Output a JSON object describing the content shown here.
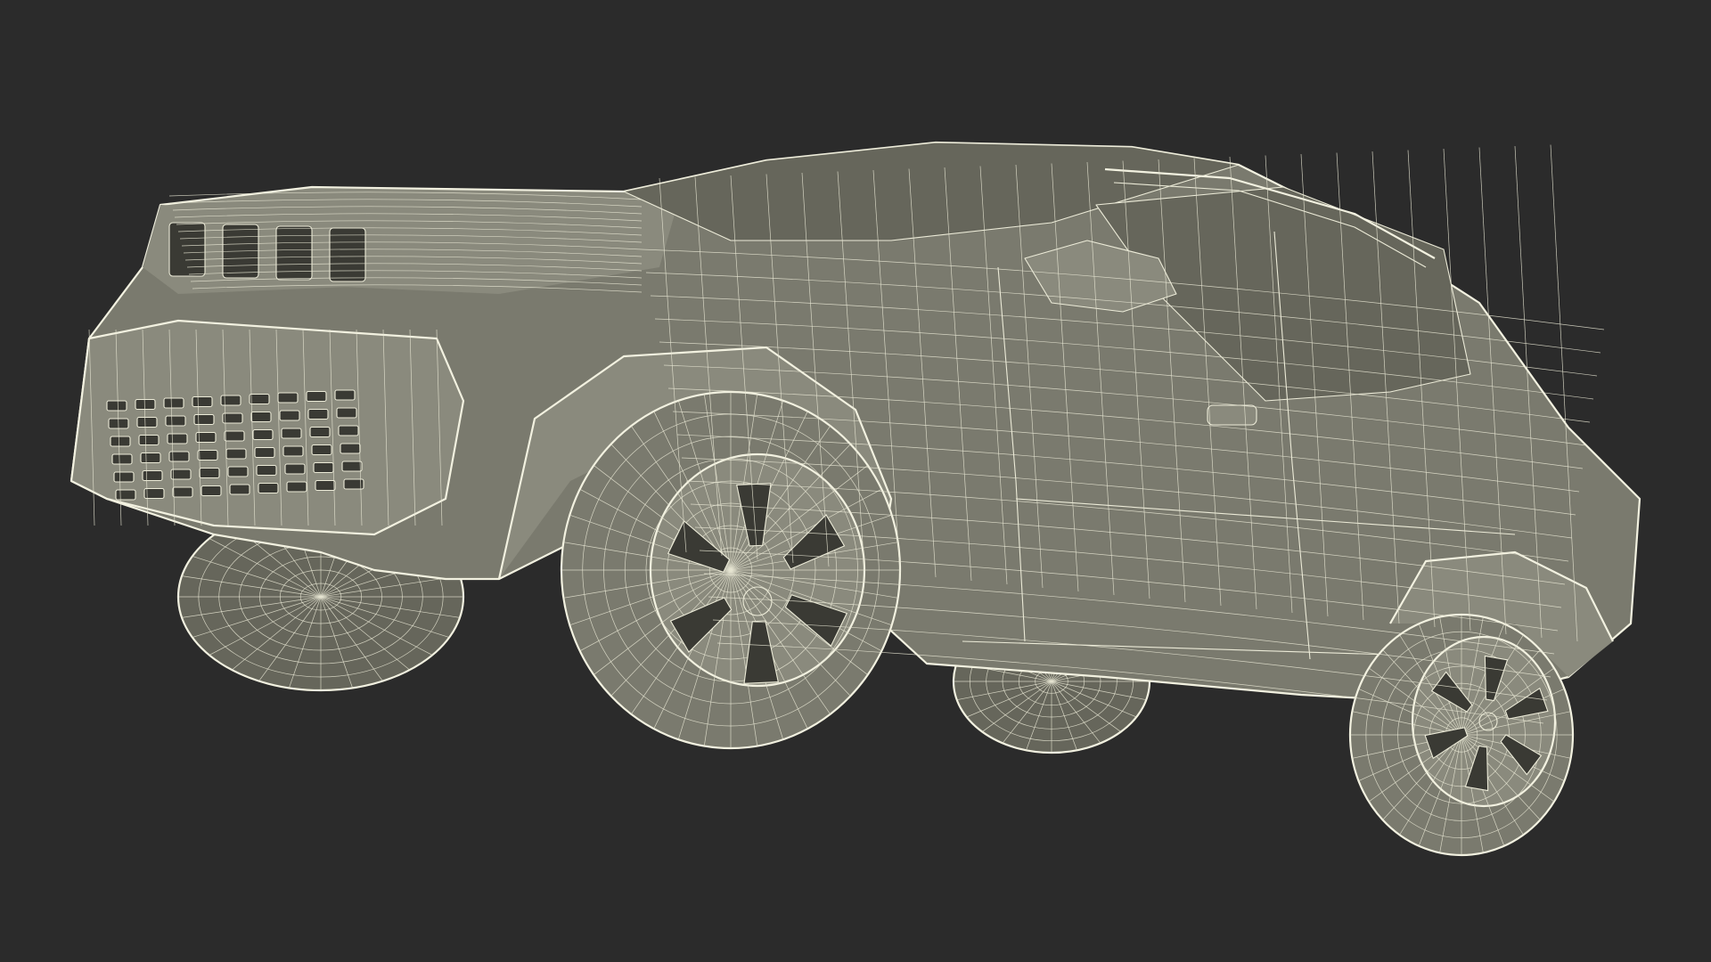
{
  "scene": {
    "background_color": "#2b2b2b",
    "wire_color": "#ecebd8",
    "surface_color": "#7a7a6e"
  }
}
